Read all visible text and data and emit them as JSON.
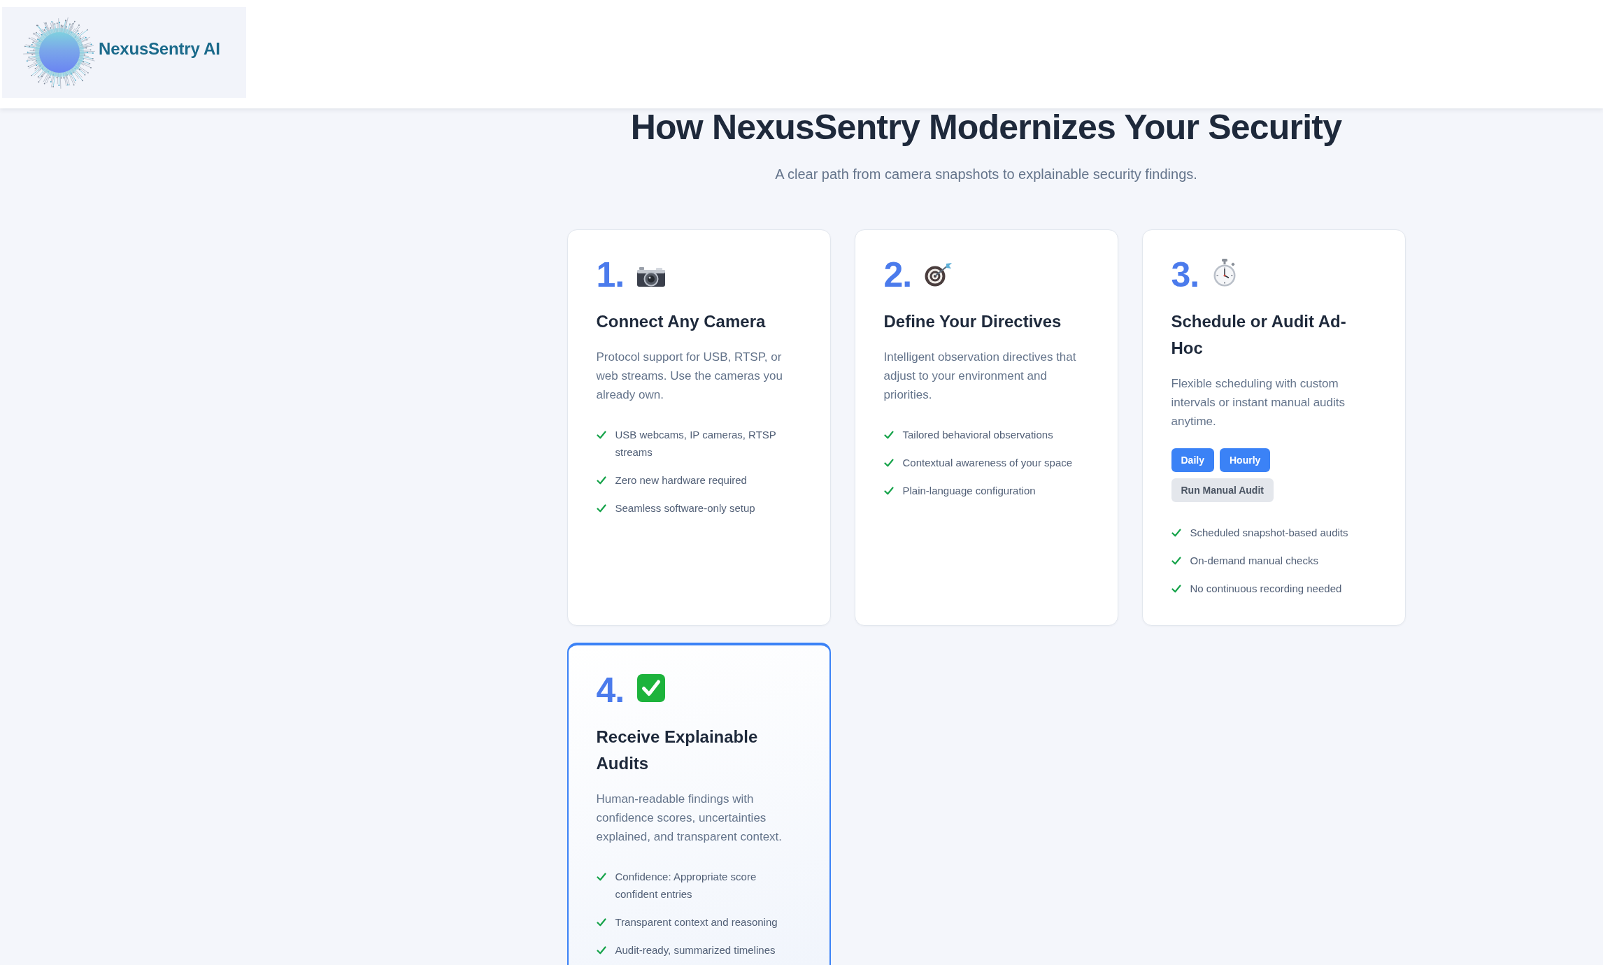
{
  "header": {
    "brand": "NexusSentry AI"
  },
  "intro": {
    "title": "How NexusSentry Modernizes Your Security",
    "subtitle": "A clear path from camera snapshots to explainable security findings."
  },
  "steps": [
    {
      "number": "1.",
      "title": "Connect Any Camera",
      "description": "Protocol support for USB, RTSP, or web streams. Use the cameras you already own.",
      "highlighted": false,
      "features": [
        "USB webcams, IP cameras, RTSP streams",
        "Zero new hardware required",
        "Seamless software-only setup"
      ]
    },
    {
      "number": "2.",
      "title": "Define Your Directives",
      "description": "Intelligent observation directives that adjust to your environment and priorities.",
      "highlighted": false,
      "features": [
        "Tailored behavioral observations",
        "Contextual awareness of your space",
        "Plain-language configuration"
      ]
    },
    {
      "number": "3.",
      "title": "Schedule or Audit Ad-Hoc",
      "description": "Flexible scheduling with custom intervals or instant manual audits anytime.",
      "highlighted": false,
      "buttons": [
        {
          "label": "Daily",
          "kind": "primary"
        },
        {
          "label": "Hourly",
          "kind": "primary"
        },
        {
          "label": "Run Manual Audit",
          "kind": "secondary"
        }
      ],
      "features": [
        "Scheduled snapshot-based audits",
        "On-demand manual checks",
        "No continuous recording needed"
      ]
    },
    {
      "number": "4.",
      "title": "Receive Explainable Audits",
      "description": "Human-readable findings with confidence scores, uncertainties explained, and transparent context.",
      "highlighted": true,
      "features": [
        "Confidence: Appropriate score confident entries",
        "Transparent context and reasoning",
        "Audit-ready, summarized timelines"
      ]
    }
  ]
}
